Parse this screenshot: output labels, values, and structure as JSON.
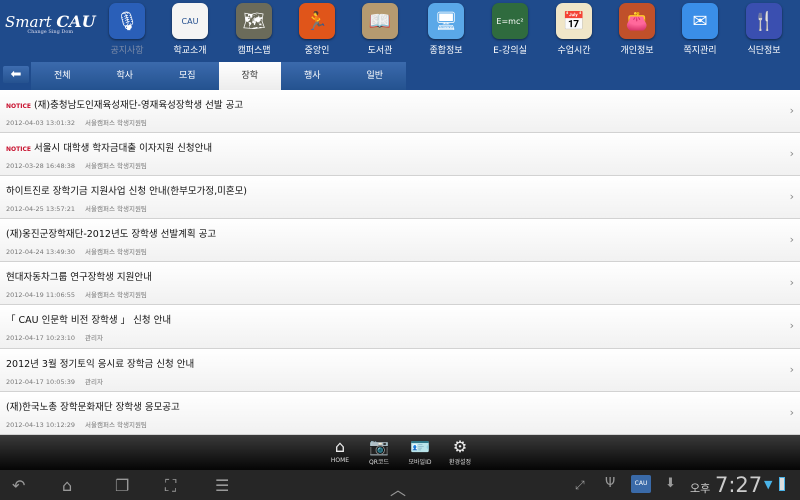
{
  "header": {
    "logo": "Smart",
    "logo_brand": "CAU",
    "logo_sub": "Change Sing Dom",
    "apps": [
      {
        "label": "공지사항",
        "icon": "microphone-icon",
        "color": "#2a5fb8",
        "glyph": "🎙"
      },
      {
        "label": "학교소개",
        "icon": "cau-logo-icon",
        "color": "#f4f4f4",
        "glyph": "CAU"
      },
      {
        "label": "캠퍼스맵",
        "icon": "map-icon",
        "color": "#6b6b5a",
        "glyph": "🗺"
      },
      {
        "label": "중앙인",
        "icon": "person-running-icon",
        "color": "#e0551a",
        "glyph": "🏃"
      },
      {
        "label": "도서관",
        "icon": "book-icon",
        "color": "#b59a70",
        "glyph": "📖"
      },
      {
        "label": "종합정보",
        "icon": "monitor-folder-icon",
        "color": "#5aa8e8",
        "glyph": "🖥"
      },
      {
        "label": "E-강의실",
        "icon": "chalkboard-icon",
        "color": "#2f6b3e",
        "glyph": "E=mc²"
      },
      {
        "label": "수업시간",
        "icon": "calendar-icon",
        "color": "#f0e6c8",
        "glyph": "📅"
      },
      {
        "label": "개인정보",
        "icon": "wallet-icon",
        "color": "#c0502a",
        "glyph": "👛"
      },
      {
        "label": "쪽지관리",
        "icon": "envelope-icon",
        "color": "#3a8ee8",
        "glyph": "✉"
      },
      {
        "label": "식단정보",
        "icon": "fork-spoon-icon",
        "color": "#3a4fb0",
        "glyph": "🍴"
      }
    ]
  },
  "tabs": [
    "전체",
    "학사",
    "모집",
    "장학",
    "행사",
    "일반"
  ],
  "active_tab": "장학",
  "notice_label": "NOTICE",
  "items": [
    {
      "notice": true,
      "title": "(재)충청남도인재육성재단-영재육성장학생 선발 공고",
      "date": "2012-04-03 13:01:32",
      "author": "서울캠퍼스 학생지원팀"
    },
    {
      "notice": true,
      "title": "서울시 대학생 학자금대출 이자지원 신청안내",
      "date": "2012-03-28 16:48:38",
      "author": "서울캠퍼스 학생지원팀"
    },
    {
      "notice": false,
      "title": "하이트진로 장학기금 지원사업 신청 안내(한부모가정,미혼모)",
      "date": "2012-04-25 13:57:21",
      "author": "서울캠퍼스 학생지원팀"
    },
    {
      "notice": false,
      "title": "(재)옹진군장학재단-2012년도 장학생 선발계획 공고",
      "date": "2012-04-24 13:49:30",
      "author": "서울캠퍼스 학생지원팀"
    },
    {
      "notice": false,
      "title": "현대자동차그룹 연구장학생 지원안내",
      "date": "2012-04-19 11:06:55",
      "author": "서울캠퍼스 학생지원팀"
    },
    {
      "notice": false,
      "title": "「 CAU 인문학 비전 장학생 」 신청 안내",
      "date": "2012-04-17 10:23:10",
      "author": "관리자"
    },
    {
      "notice": false,
      "title": "2012년 3월 정기토익 응시료 장학금 신청 안내",
      "date": "2012-04-17 10:05:39",
      "author": "관리자"
    },
    {
      "notice": false,
      "title": "(재)한국노총 장학문화재단 장학생 응모공고",
      "date": "2012-04-13 10:12:29",
      "author": "서울캠퍼스 학생지원팀"
    }
  ],
  "appbar": [
    {
      "label": "HOME",
      "icon": "home-icon",
      "glyph": "⌂"
    },
    {
      "label": "QR코드",
      "icon": "camera-icon",
      "glyph": "📷"
    },
    {
      "label": "모바일ID",
      "icon": "id-card-icon",
      "glyph": "🪪"
    },
    {
      "label": "환경설정",
      "icon": "gear-icon",
      "glyph": "⚙"
    }
  ],
  "status": {
    "ampm": "오후",
    "time": "7:27"
  }
}
